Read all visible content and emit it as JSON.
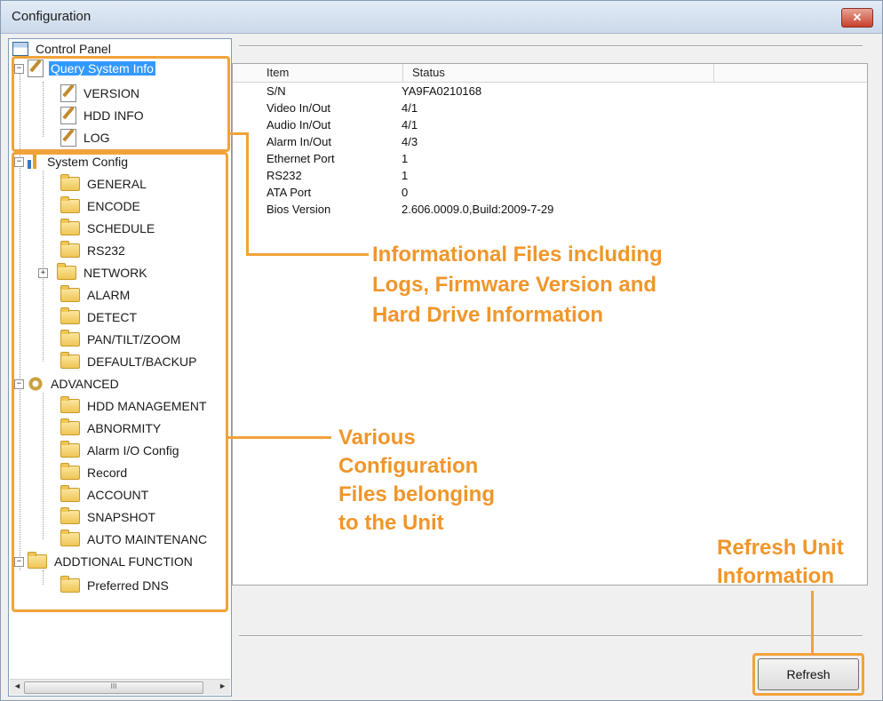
{
  "window": {
    "title": "Configuration",
    "close_glyph": "✕"
  },
  "tree": {
    "root_label": "Control Panel",
    "query": {
      "label": "Query System Info",
      "children": [
        "VERSION",
        "HDD INFO",
        "LOG"
      ]
    },
    "system_config": {
      "label": "System Config",
      "children": [
        "GENERAL",
        "ENCODE",
        "SCHEDULE",
        "RS232",
        "NETWORK",
        "ALARM",
        "DETECT",
        "PAN/TILT/ZOOM",
        "DEFAULT/BACKUP"
      ]
    },
    "advanced": {
      "label": "ADVANCED",
      "children": [
        "HDD MANAGEMENT",
        "ABNORMITY",
        "Alarm I/O Config",
        "Record",
        "ACCOUNT",
        "SNAPSHOT",
        "AUTO MAINTENANC"
      ]
    },
    "additional": {
      "label": "ADDTIONAL FUNCTION",
      "children": [
        "Preferred DNS"
      ]
    }
  },
  "scroll": {
    "left_arrow": "◄",
    "right_arrow": "►",
    "grip": "III"
  },
  "table": {
    "columns": [
      "Item",
      "Status"
    ],
    "rows": [
      [
        "S/N",
        "YA9FA0210168"
      ],
      [
        "Video In/Out",
        "4/1"
      ],
      [
        "Audio In/Out",
        "4/1"
      ],
      [
        "Alarm In/Out",
        "4/3"
      ],
      [
        "Ethernet Port",
        "1"
      ],
      [
        "RS232",
        "1"
      ],
      [
        "ATA Port",
        "0"
      ],
      [
        "Bios Version",
        "2.606.0009.0,Build:2009-7-29"
      ]
    ]
  },
  "buttons": {
    "refresh": "Refresh"
  },
  "annotations": {
    "info_lines": [
      "Informational Files including",
      "Logs, Firmware Version and",
      "Hard Drive Information"
    ],
    "config_lines": [
      "Various",
      "Configuration",
      "Files belonging",
      "to the Unit"
    ],
    "refresh_lines": [
      "Refresh Unit",
      "Information"
    ]
  },
  "colors": {
    "annotation": "#f2a23a",
    "selection": "#3399ff"
  }
}
